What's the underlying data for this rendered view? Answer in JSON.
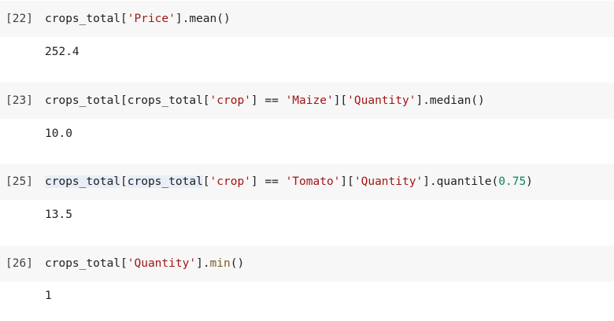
{
  "cells": [
    {
      "prompt": "[22]",
      "code": {
        "var": "crops_total",
        "lb1": "[",
        "s1": "'Price'",
        "rb1": "]",
        "method": ".mean()"
      },
      "output": "252.4"
    },
    {
      "prompt": "[23]",
      "code": {
        "var": "crops_total",
        "lb1": "[",
        "var2": "crops_total",
        "lb2": "[",
        "s1": "'crop'",
        "rb2": "]",
        "op": " == ",
        "s2": "'Maize'",
        "rb1": "]",
        "lb3": "[",
        "s3": "'Quantity'",
        "rb3": "]",
        "method": ".median()"
      },
      "output": "10.0"
    },
    {
      "prompt": "[25]",
      "code": {
        "var": "crops_total",
        "lb1": "[",
        "var2": "crops_total",
        "lb2": "[",
        "s1": "'crop'",
        "rb2": "]",
        "op": " == ",
        "s2": "'Tomato'",
        "rb1": "]",
        "lb3": "[",
        "s3": "'Quantity'",
        "rb3": "]",
        "method": ".quantile(",
        "num": "0.75",
        "close": ")"
      },
      "output": "13.5"
    },
    {
      "prompt": "[26]",
      "code": {
        "var": "crops_total",
        "lb1": "[",
        "s1": "'Quantity'",
        "rb1": "]",
        "dot": ".",
        "fn": "min",
        "call": "()"
      },
      "output": "1"
    }
  ]
}
